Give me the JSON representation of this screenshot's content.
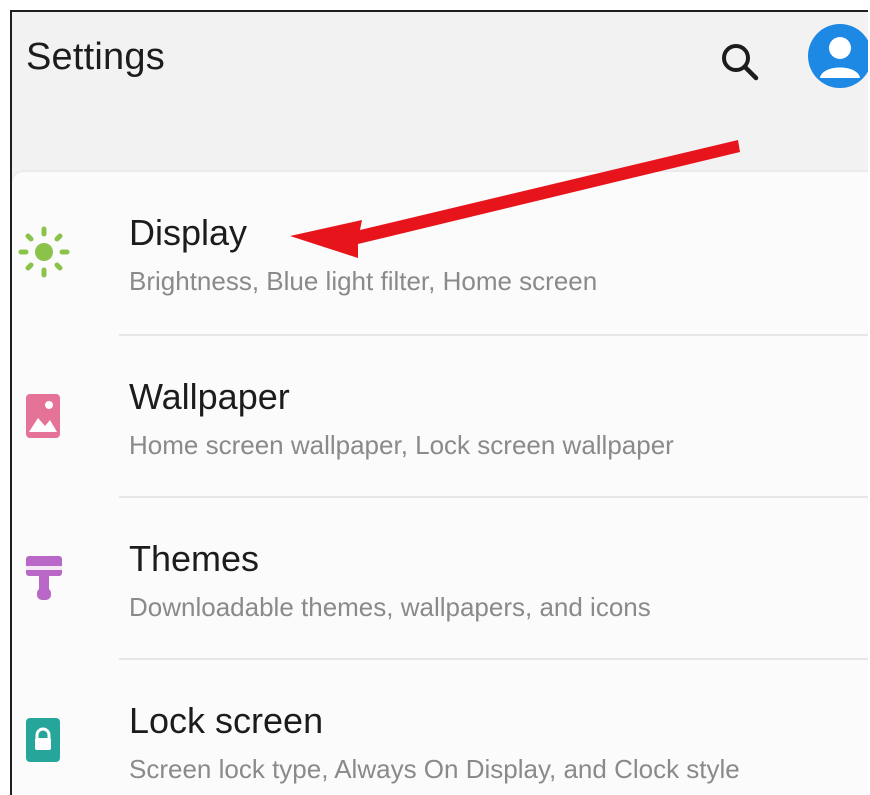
{
  "app": {
    "title": "Settings"
  },
  "header": {
    "search_icon": "search-icon",
    "account_icon": "account-avatar-icon"
  },
  "items": [
    {
      "label": "Display",
      "summary": "Brightness, Blue light filter, Home screen",
      "icon": "brightness-sun-icon",
      "icon_color": "#8bc34a"
    },
    {
      "label": "Wallpaper",
      "summary": "Home screen wallpaper, Lock screen wallpaper",
      "icon": "wallpaper-image-icon",
      "icon_color": "#e57398"
    },
    {
      "label": "Themes",
      "summary": "Downloadable themes, wallpapers, and icons",
      "icon": "themes-brush-icon",
      "icon_color": "#ba68c8"
    },
    {
      "label": "Lock screen",
      "summary": "Screen lock type, Always On Display, and Clock style",
      "icon": "lock-icon",
      "icon_color": "#26a69a"
    }
  ],
  "colors": {
    "accent_blue": "#1e88e5",
    "annotation_red": "#e8141b",
    "header_bg": "#f2f2f2",
    "card_bg": "#fbfbfb",
    "primary_text": "#1c1c1c",
    "secondary_text": "#8a8a8a"
  }
}
